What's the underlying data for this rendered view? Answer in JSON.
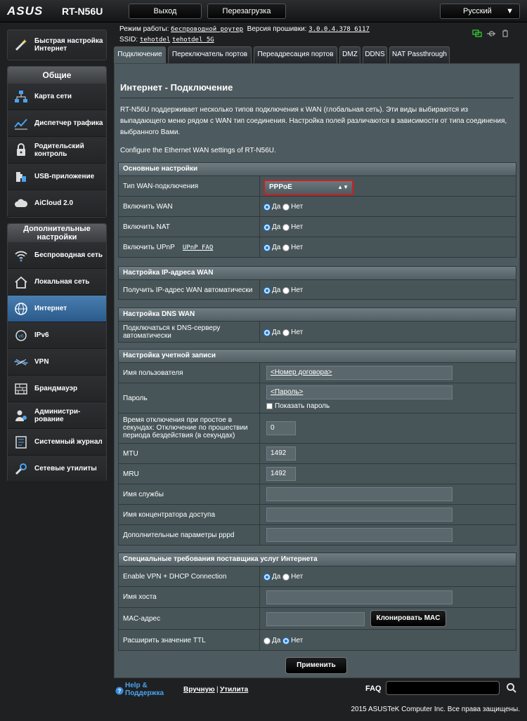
{
  "header": {
    "logo": "ASUS",
    "model": "RT-N56U",
    "logout": "Выход",
    "reboot": "Перезагрузка",
    "language": "Русский"
  },
  "info": {
    "mode_label": "Режим работы:",
    "mode_value": "беспроводной роутер",
    "fw_label": "Версия прошивки:",
    "fw_value": "3.0.0.4.378_6117",
    "ssid_label": "SSID:",
    "ssid1": "tehotdel",
    "ssid2": "tehotdel_5G"
  },
  "sidebar": {
    "quick": "Быстрая настройка Интернет",
    "general_head": "Общие",
    "general": [
      {
        "label": "Карта сети",
        "icon": "network-map-icon"
      },
      {
        "label": "Диспетчер трафика",
        "icon": "traffic-icon"
      },
      {
        "label": "Родительский контроль",
        "icon": "parental-icon"
      },
      {
        "label": "USB-приложение",
        "icon": "usb-app-icon"
      },
      {
        "label": "AiCloud 2.0",
        "icon": "cloud-icon"
      }
    ],
    "advanced_head": "Дополнительные настройки",
    "advanced": [
      {
        "label": "Беспроводная сеть",
        "icon": "wireless-icon"
      },
      {
        "label": "Локальная сеть",
        "icon": "home-icon"
      },
      {
        "label": "Интернет",
        "icon": "globe-icon"
      },
      {
        "label": "IPv6",
        "icon": "ipv6-icon"
      },
      {
        "label": "VPN",
        "icon": "vpn-icon"
      },
      {
        "label": "Брандмауэр",
        "icon": "firewall-icon"
      },
      {
        "label": "Администри-рование",
        "icon": "admin-icon"
      },
      {
        "label": "Системный журнал",
        "icon": "log-icon"
      },
      {
        "label": "Сетевые утилиты",
        "icon": "tools-icon"
      }
    ]
  },
  "tabs": [
    "Подключение",
    "Переключатель портов",
    "Переадресация портов",
    "DMZ",
    "DDNS",
    "NAT Passthrough"
  ],
  "main": {
    "title": "Интернет - Подключение",
    "desc": "RT-N56U поддерживает несколько типов подключения к WAN (глобальная сеть). Эти виды выбираются из выпадающего меню рядом с WAN тип соединения. Настройка полей различаются в зависимости от типа соединения, выбранного Вами.",
    "desc2": "Configure the Ethernet WAN settings of RT-N56U.",
    "yes": "Да",
    "no": "Нет",
    "basic": {
      "head": "Основные настройки",
      "wan_type_label": "Тип WAN-подключения",
      "wan_type_value": "PPPoE",
      "enable_wan": "Включить WAN",
      "enable_nat": "Включить NAT",
      "enable_upnp": "Включить UPnP",
      "upnp_faq": "UPnP FAQ"
    },
    "ip": {
      "head": "Настройка IP-адреса WAN",
      "auto_ip": "Получить IP-адрес WAN автоматически"
    },
    "dns": {
      "head": "Настройка DNS WAN",
      "auto_dns": "Подключаться к DNS-серверу автоматически"
    },
    "account": {
      "head": "Настройка учетной записи",
      "username_label": "Имя пользователя",
      "username_value": "<Номер договора>",
      "password_label": "Пароль",
      "password_value": "<Пароль>",
      "show_password": "Показать пароль",
      "idle_label": "Время отключения при простое в секундах: Отключение по прошествии периода бездействия (в секундах)",
      "idle_value": "0",
      "mtu_label": "MTU",
      "mtu_value": "1492",
      "mru_label": "MRU",
      "mru_value": "1492",
      "service_label": "Имя службы",
      "ac_label": "Имя концентратора доступа",
      "pppd_label": "Дополнительные параметры pppd"
    },
    "isp": {
      "head": "Специальные требования поставщика услуг Интернета",
      "vpn_dhcp": "Enable VPN + DHCP Connection",
      "hostname": "Имя хоста",
      "mac": "MAC-адрес",
      "clone_mac": "Клонировать MAC",
      "ttl": "Расширить значение TTL"
    },
    "apply": "Применить"
  },
  "footer": {
    "help": "Help & Поддержка",
    "manual": "Вручную",
    "sep": "|",
    "utility": "Утилита",
    "faq": "FAQ",
    "copyright": "2015 ASUSTeK Computer Inc. Все права защищены."
  }
}
